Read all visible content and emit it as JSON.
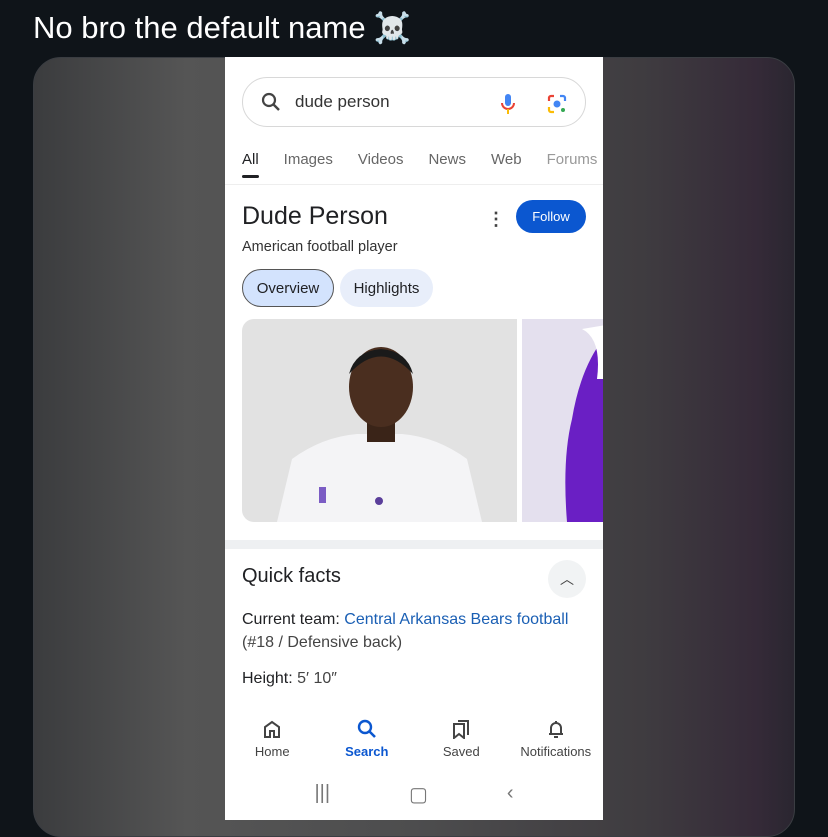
{
  "post": {
    "caption": "No bro the default name",
    "emoji": "☠️"
  },
  "search": {
    "query": "dude person"
  },
  "tabs": [
    "All",
    "Images",
    "Videos",
    "News",
    "Web",
    "Forums"
  ],
  "entity": {
    "name": "Dude Person",
    "subtitle": "American football player",
    "follow_label": "Follow",
    "chips": [
      "Overview",
      "Highlights"
    ]
  },
  "quick_facts": {
    "title": "Quick facts",
    "team_label": "Current team:",
    "team_link": "Central Arkansas Bears football",
    "team_detail": "(#18 / Defensive back)",
    "height_label": "Height:",
    "height_value": "5′ 10″"
  },
  "bottom_nav": [
    {
      "label": "Home",
      "icon": "home-icon"
    },
    {
      "label": "Search",
      "icon": "search-icon",
      "active": true
    },
    {
      "label": "Saved",
      "icon": "saved-icon"
    },
    {
      "label": "Notifications",
      "icon": "bell-icon"
    }
  ],
  "colors": {
    "accent": "#0b57d0",
    "link": "#1a5fb4",
    "chip_selected": "#d3e3fd"
  }
}
